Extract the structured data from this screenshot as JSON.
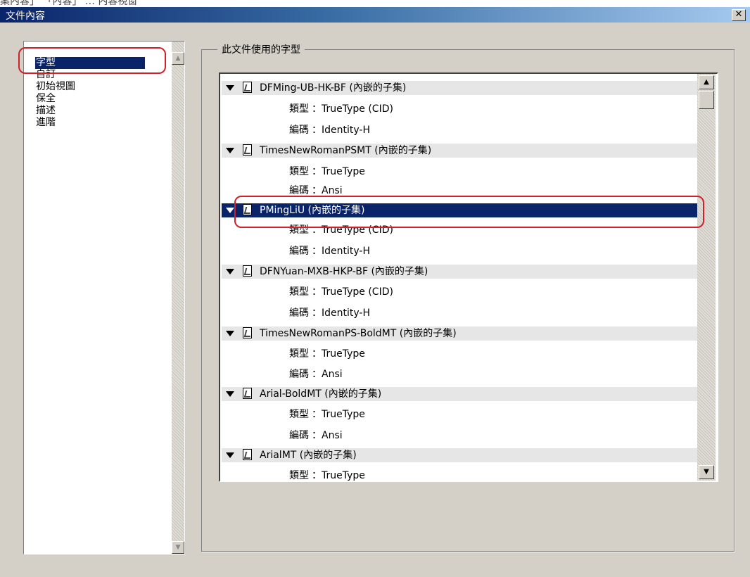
{
  "caption_fragment": "案內容」  「內容」  …  內容視窗",
  "window": {
    "title": "文件內容",
    "close_label": "✕"
  },
  "categories": [
    "字型",
    "自訂",
    "初始視圖",
    "保全",
    "描述",
    "進階"
  ],
  "selected_category": "字型",
  "fonts_group": {
    "label": "此文件使用的字型"
  },
  "labels": {
    "type": "類型",
    "encoding": "編碼"
  },
  "fonts": [
    {
      "name": "DFMing-UB-HK-BF (內嵌的子集)",
      "type": "TrueType (CID)",
      "encoding": "Identity-H"
    },
    {
      "name": "TimesNewRomanPSMT (內嵌的子集)",
      "type": "TrueType",
      "encoding": "Ansi"
    },
    {
      "name": "PMingLiU (內嵌的子集)",
      "type": "TrueType (CID)",
      "encoding": "Identity-H",
      "selected": true
    },
    {
      "name": "DFNYuan-MXB-HKP-BF (內嵌的子集)",
      "type": "TrueType (CID)",
      "encoding": "Identity-H"
    },
    {
      "name": "TimesNewRomanPS-BoldMT (內嵌的子集)",
      "type": "TrueType",
      "encoding": "Ansi"
    },
    {
      "name": "Arial-BoldMT (內嵌的子集)",
      "type": "TrueType",
      "encoding": "Ansi"
    },
    {
      "name": "ArialMT (內嵌的子集)",
      "type": "TrueType",
      "encoding": ""
    }
  ],
  "icons": {
    "expand": "triangle-down-icon",
    "font_file": "font-file-icon",
    "scroll_up": "scroll-up-arrow-icon",
    "scroll_down": "scroll-down-arrow-icon"
  },
  "colors": {
    "selection": "#0a246a",
    "highlight_outline": "#d0202a",
    "dialog_face": "#d4d0c8",
    "font_row": "#e6e6e6"
  }
}
